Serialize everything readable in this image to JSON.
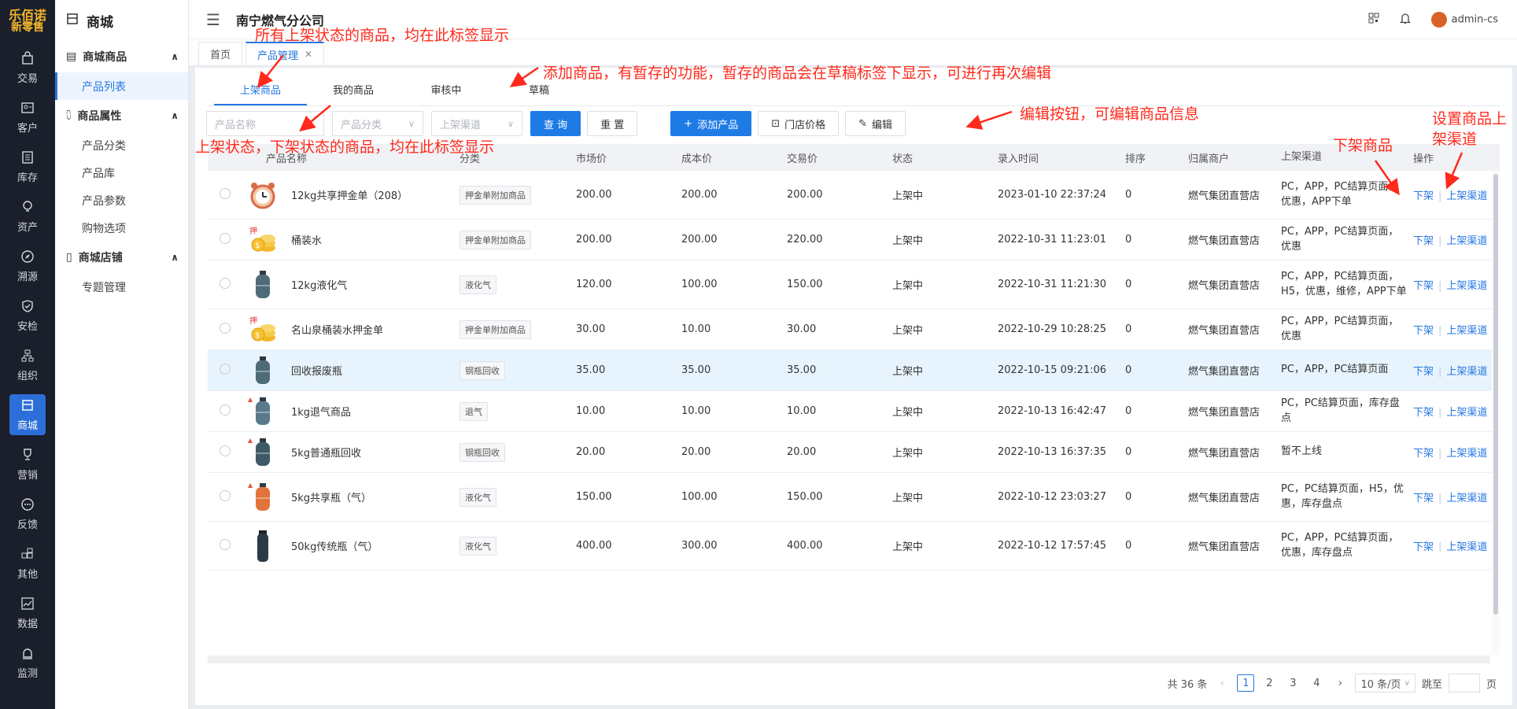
{
  "brand": {
    "line1": "乐佰诺",
    "line2": "新零售"
  },
  "rail": [
    {
      "label": "交易",
      "icon": "bag-icon"
    },
    {
      "label": "客户",
      "icon": "id-card-icon"
    },
    {
      "label": "库存",
      "icon": "list-box-icon"
    },
    {
      "label": "资产",
      "icon": "bulb-icon"
    },
    {
      "label": "溯源",
      "icon": "compass-icon"
    },
    {
      "label": "安检",
      "icon": "shield-check-icon"
    },
    {
      "label": "组织",
      "icon": "org-chart-icon"
    },
    {
      "label": "商城",
      "icon": "store-icon",
      "active": true
    },
    {
      "label": "营销",
      "icon": "trophy-icon"
    },
    {
      "label": "反馈",
      "icon": "chat-dots-icon"
    },
    {
      "label": "其他",
      "icon": "grid-plus-icon"
    },
    {
      "label": "数据",
      "icon": "trend-chart-icon"
    },
    {
      "label": "监测",
      "icon": "alarm-icon"
    }
  ],
  "sidebar": {
    "title": "商城",
    "groups": [
      {
        "label": "商城商品",
        "items": [
          "产品列表"
        ]
      },
      {
        "label": "商品属性",
        "items": [
          "产品分类",
          "产品库",
          "产品参数",
          "购物选项"
        ]
      },
      {
        "label": "商城店铺",
        "items": [
          "专题管理"
        ]
      }
    ]
  },
  "topbar": {
    "company": "南宁燃气分公司",
    "user": "admin-cs"
  },
  "tags": {
    "home": "首页",
    "current": "产品管理"
  },
  "subtabs": [
    "上架商品",
    "我的商品",
    "审核中",
    "草稿"
  ],
  "filters": {
    "name_placeholder": "产品名称",
    "category_placeholder": "产品分类",
    "channel_placeholder": "上架渠道",
    "query": "查 询",
    "reset": "重 置",
    "add": "添加产品",
    "store_price": "门店价格",
    "edit": "编辑"
  },
  "columns": [
    "产品名称",
    "分类",
    "市场价",
    "成本价",
    "交易价",
    "状态",
    "录入时间",
    "排序",
    "归属商户",
    "上架渠道",
    "操作"
  ],
  "rows": [
    {
      "name": "12kg共享押金单（208）",
      "category": "押金单附加商品",
      "market": "200.00",
      "cost": "200.00",
      "trade": "200.00",
      "status": "上架中",
      "time": "2023-01-10 22:37:24",
      "sort": "0",
      "merchant": "燃气集团直营店",
      "channel": "PC，APP，PC结算页面，优惠，APP下单",
      "thumb": "clock"
    },
    {
      "name": "桶装水",
      "category": "押金单附加商品",
      "market": "200.00",
      "cost": "200.00",
      "trade": "220.00",
      "status": "上架中",
      "time": "2022-10-31 11:23:01",
      "sort": "0",
      "merchant": "燃气集团直营店",
      "channel": "PC，APP，PC结算页面，优惠",
      "thumb": "coin"
    },
    {
      "name": "12kg液化气",
      "category": "液化气",
      "market": "120.00",
      "cost": "100.00",
      "trade": "150.00",
      "status": "上架中",
      "time": "2022-10-31 11:21:30",
      "sort": "0",
      "merchant": "燃气集团直营店",
      "channel": "PC，APP，PC结算页面，H5，优惠，维修，APP下单",
      "thumb": "tank"
    },
    {
      "name": "名山泉桶装水押金单",
      "category": "押金单附加商品",
      "market": "30.00",
      "cost": "10.00",
      "trade": "30.00",
      "status": "上架中",
      "time": "2022-10-29 10:28:25",
      "sort": "0",
      "merchant": "燃气集团直营店",
      "channel": "PC，APP，PC结算页面，优惠",
      "thumb": "coin"
    },
    {
      "name": "回收报废瓶",
      "category": "钢瓶回收",
      "market": "35.00",
      "cost": "35.00",
      "trade": "35.00",
      "status": "上架中",
      "time": "2022-10-15 09:21:06",
      "sort": "0",
      "merchant": "燃气集团直营店",
      "channel": "PC，APP，PC结算页面",
      "thumb": "tank",
      "highlight": true
    },
    {
      "name": "1kg退气商品",
      "category": "退气",
      "market": "10.00",
      "cost": "10.00",
      "trade": "10.00",
      "status": "上架中",
      "time": "2022-10-13 16:42:47",
      "sort": "0",
      "merchant": "燃气集团直营店",
      "channel": "PC，PC结算页面，库存盘点",
      "thumb": "tank-s"
    },
    {
      "name": "5kg普通瓶回收",
      "category": "钢瓶回收",
      "market": "20.00",
      "cost": "20.00",
      "trade": "20.00",
      "status": "上架中",
      "time": "2022-10-13 16:37:35",
      "sort": "0",
      "merchant": "燃气集团直营店",
      "channel": "暂不上线",
      "thumb": "tank-d"
    },
    {
      "name": "5kg共享瓶（气）",
      "category": "液化气",
      "market": "150.00",
      "cost": "100.00",
      "trade": "150.00",
      "status": "上架中",
      "time": "2022-10-12 23:03:27",
      "sort": "0",
      "merchant": "燃气集团直营店",
      "channel": "PC，PC结算页面，H5，优惠，库存盘点",
      "thumb": "tank-o"
    },
    {
      "name": "50kg传统瓶（气）",
      "category": "液化气",
      "market": "400.00",
      "cost": "300.00",
      "trade": "400.00",
      "status": "上架中",
      "time": "2022-10-12 17:57:45",
      "sort": "0",
      "merchant": "燃气集团直营店",
      "channel": "PC，APP，PC结算页面，优惠，库存盘点",
      "thumb": "tank-tall"
    }
  ],
  "row_actions": {
    "off": "下架",
    "channel": "上架渠道"
  },
  "pagination": {
    "total": "共 36 条",
    "pages": [
      "1",
      "2",
      "3",
      "4"
    ],
    "current": "1",
    "size": "10 条/页",
    "jump": "跳至",
    "page_unit": "页"
  },
  "annotations": {
    "listed": "所有上架状态的商品，均在此标签显示",
    "mine": "上架状态，下架状态的商品，均在此标签显示",
    "draft": "添加商品，有暂存的功能，暂存的商品会在草稿标签下显示，可进行再次编辑",
    "edit": "编辑按钮，可编辑商品信息",
    "off": "下架商品",
    "channel1": "设置商品上",
    "channel2": "架渠道"
  },
  "colors": {
    "accent": "#1e7be6",
    "rail": "#1a1f2b",
    "annotation": "#ff2a1c"
  }
}
